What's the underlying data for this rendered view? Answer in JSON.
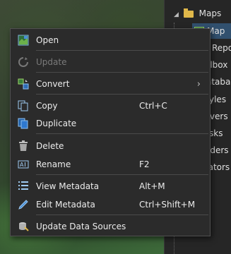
{
  "catalog": {
    "root_label": "Maps",
    "selected_label": "Map",
    "rows": [
      "Repo",
      "olbox",
      "ataba",
      "yles",
      "rvers",
      "sks",
      "lders",
      "cators"
    ]
  },
  "menu": {
    "items": [
      {
        "label": "Open",
        "shortcut": "",
        "icon": "open-map-icon",
        "enabled": true
      },
      {
        "label": "Update",
        "shortcut": "",
        "icon": "update-icon",
        "enabled": false
      },
      {
        "label": "Convert",
        "shortcut": "",
        "icon": "convert-icon",
        "enabled": true,
        "submenu": true
      },
      {
        "label": "Copy",
        "shortcut": "Ctrl+C",
        "icon": "copy-icon",
        "enabled": true
      },
      {
        "label": "Duplicate",
        "shortcut": "",
        "icon": "duplicate-icon",
        "enabled": true
      },
      {
        "label": "Delete",
        "shortcut": "",
        "icon": "trash-icon",
        "enabled": true
      },
      {
        "label": "Rename",
        "shortcut": "F2",
        "icon": "rename-icon",
        "enabled": true
      },
      {
        "label": "View Metadata",
        "shortcut": "Alt+M",
        "icon": "view-metadata-icon",
        "enabled": true
      },
      {
        "label": "Edit Metadata",
        "shortcut": "Ctrl+Shift+M",
        "icon": "edit-metadata-icon",
        "enabled": true
      },
      {
        "label": "Update Data Sources",
        "shortcut": "",
        "icon": "update-data-sources-icon",
        "enabled": true
      }
    ]
  },
  "colors": {
    "menu_bg": "#2b2b2b",
    "selection": "#31506e",
    "disabled_text": "#7a7a7a"
  }
}
